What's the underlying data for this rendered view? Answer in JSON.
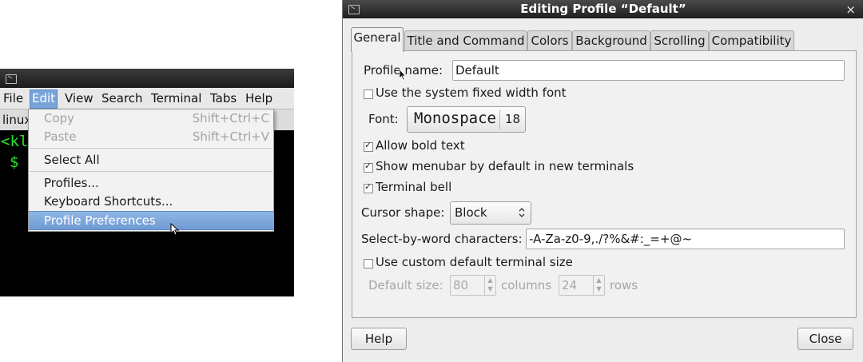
{
  "terminal": {
    "menubar": [
      "File",
      "Edit",
      "View",
      "Search",
      "Terminal",
      "Tabs",
      "Help"
    ],
    "tab_label": "linux",
    "prompt_line1": "<kl",
    "prompt_line2": "$",
    "text_color": "#2de02d",
    "edit_menu": {
      "copy": {
        "label": "Copy",
        "accel": "Shift+Ctrl+C"
      },
      "paste": {
        "label": "Paste",
        "accel": "Shift+Ctrl+V"
      },
      "select_all": "Select All",
      "profiles": "Profiles...",
      "keyboard_shortcuts": "Keyboard Shortcuts...",
      "profile_preferences": "Profile Preferences"
    }
  },
  "dialog": {
    "title": "Editing Profile “Default”",
    "close_glyph": "×",
    "tabs": [
      "General",
      "Title and Command",
      "Colors",
      "Background",
      "Scrolling",
      "Compatibility"
    ],
    "profile_name_label": "Profile name:",
    "profile_name_value": "Default",
    "system_font_label": "Use the system fixed width font",
    "font_label": "Font:",
    "font_name": "Monospace",
    "font_size": "18",
    "allow_bold_label": "Allow bold text",
    "show_menubar_label": "Show menubar by default in new terminals",
    "terminal_bell_label": "Terminal bell",
    "cursor_shape_label": "Cursor shape:",
    "cursor_shape_value": "Block",
    "select_word_label": "Select-by-word characters:",
    "select_word_value": "-A-Za-z0-9,./?%&#:_=+@~",
    "custom_size_label": "Use custom default terminal size",
    "default_size_label": "Default size:",
    "columns_value": "80",
    "columns_label": "columns",
    "rows_value": "24",
    "rows_label": "rows",
    "help_button": "Help",
    "close_button": "Close"
  }
}
